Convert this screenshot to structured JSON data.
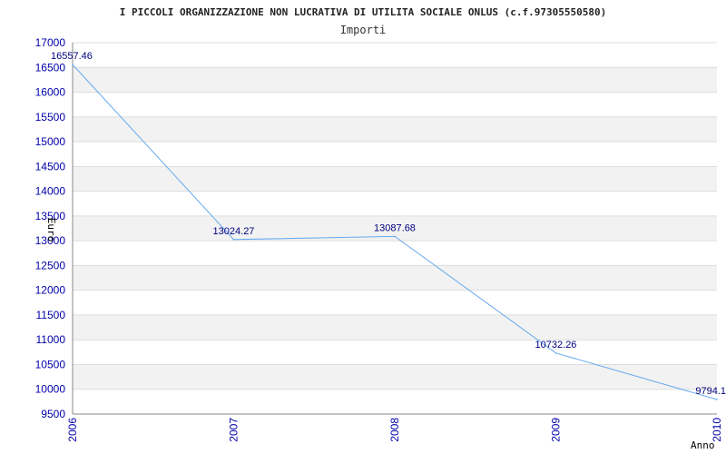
{
  "chart_data": {
    "type": "line",
    "title": "I PICCOLI ORGANIZZAZIONE NON LUCRATIVA DI UTILITA SOCIALE ONLUS (c.f.97305550580)",
    "subtitle": "Importi",
    "xlabel": "Anno",
    "ylabel": "Euro",
    "categories": [
      "2006",
      "2007",
      "2008",
      "2009",
      "2010"
    ],
    "values": [
      16557.46,
      13024.27,
      13087.68,
      10732.26,
      9794.1
    ],
    "value_labels": [
      "16557.46",
      "13024.27",
      "13087.68",
      "10732.26",
      "9794.1"
    ],
    "ylim": [
      9500,
      17000
    ],
    "yticks": [
      "9500",
      "10000",
      "10500",
      "11000",
      "11500",
      "12000",
      "12500",
      "13000",
      "13500",
      "14000",
      "14500",
      "15000",
      "15500",
      "16000",
      "16500",
      "17000"
    ],
    "grid": true,
    "legend": "none"
  },
  "colors": {
    "line": "#66aaee",
    "band": "#f2f2f2",
    "grid": "#dddddd",
    "axis": "#888888",
    "tick_text": "#0000aa",
    "data_label": "#000080"
  }
}
